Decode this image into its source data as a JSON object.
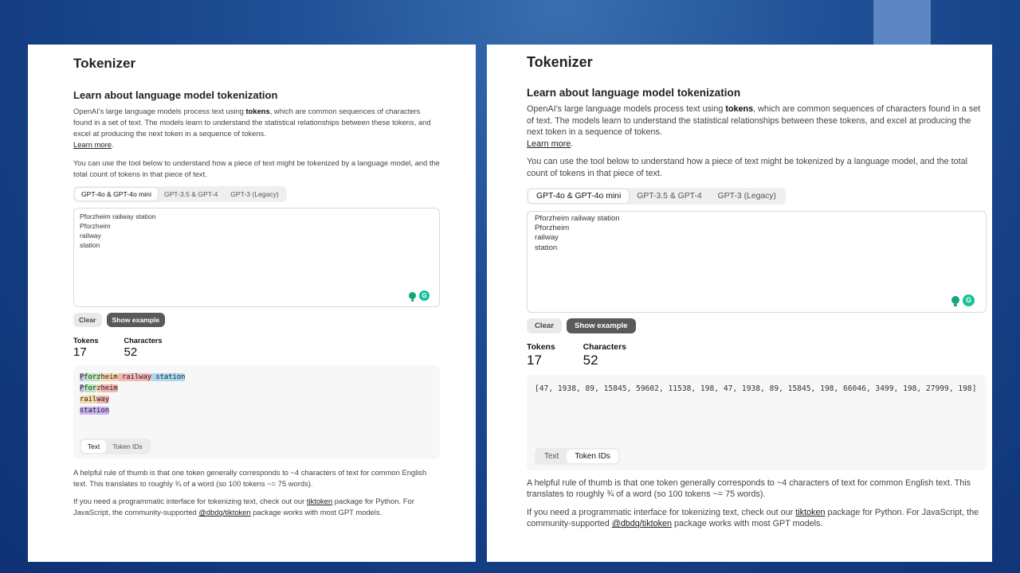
{
  "panels": [
    {
      "title": "Tokenizer",
      "subtitle": "Learn about language model tokenization",
      "intro_pre": "OpenAI's large language models process text using ",
      "intro_bold": "tokens",
      "intro_post": ", which are common sequences of characters found in a set of text. The models learn to understand the statistical relationships between these tokens, and excel at producing the next token in a sequence of tokens.",
      "learn_more": "Learn more",
      "usage": "You can use the tool below to understand how a piece of text might be tokenized by a language model, and the total count of tokens in that piece of text.",
      "model_tabs": [
        {
          "label": "GPT-4o & GPT-4o mini",
          "active": true
        },
        {
          "label": "GPT-3.5 & GPT-4",
          "active": false
        },
        {
          "label": "GPT-3 (Legacy)",
          "active": false
        }
      ],
      "input_text": "Pforzheim railway station\nPforzheim\nrailway\nstation",
      "clear_label": "Clear",
      "example_label": "Show example",
      "tokens_label": "Tokens",
      "tokens_value": "17",
      "chars_label": "Characters",
      "chars_value": "52",
      "view_tabs": [
        {
          "label": "Text",
          "active": true
        },
        {
          "label": "Token IDs",
          "active": false
        }
      ],
      "token_lines": [
        [
          {
            "t": "P",
            "c": "#c9b3f0"
          },
          {
            "t": "forz",
            "c": "#b8e6b8"
          },
          {
            "t": "heim",
            "c": "#f6d8a8"
          },
          {
            "t": " railway",
            "c": "#f4b6b6"
          },
          {
            "t": " station",
            "c": "#a9d9f2"
          }
        ],
        [
          {
            "t": "P",
            "c": "#c9b3f0"
          },
          {
            "t": "for",
            "c": "#b8e6b8"
          },
          {
            "t": "z",
            "c": "#f6d8a8"
          },
          {
            "t": "heim",
            "c": "#f4b6b6"
          }
        ],
        [
          {
            "t": "rail",
            "c": "#f6d8a8"
          },
          {
            "t": "way",
            "c": "#f4b6b6"
          }
        ],
        [
          {
            "t": "station",
            "c": "#c9b3f0"
          }
        ]
      ],
      "rule_text": "A helpful rule of thumb is that one token generally corresponds to ~4 characters of text for common English text. This translates to roughly ¾ of a word (so 100 tokens ~= 75 words).",
      "prog_pre": "If you need a programmatic interface for tokenizing text, check out our ",
      "tiktoken_link": "tiktoken",
      "prog_mid": " package for Python. For JavaScript, the community-supported ",
      "dbdq_link": "@dbdq/tiktoken",
      "prog_post": " package works with most GPT models."
    },
    {
      "title": "Tokenizer",
      "subtitle": "Learn about language model tokenization",
      "intro_pre": "OpenAI's large language models process text using ",
      "intro_bold": "tokens",
      "intro_post": ", which are common sequences of characters found in a set of text. The models learn to understand the statistical relationships between these tokens, and excel at producing the next token in a sequence of tokens.",
      "learn_more": "Learn more",
      "usage": "You can use the tool below to understand how a piece of text might be tokenized by a language model, and the total count of tokens in that piece of text.",
      "model_tabs": [
        {
          "label": "GPT-4o & GPT-4o mini",
          "active": true
        },
        {
          "label": "GPT-3.5 & GPT-4",
          "active": false
        },
        {
          "label": "GPT-3 (Legacy)",
          "active": false
        }
      ],
      "input_text": "Pforzheim railway station\nPforzheim\nrailway\nstation",
      "clear_label": "Clear",
      "example_label": "Show example",
      "tokens_label": "Tokens",
      "tokens_value": "17",
      "chars_label": "Characters",
      "chars_value": "52",
      "view_tabs": [
        {
          "label": "Text",
          "active": false
        },
        {
          "label": "Token IDs",
          "active": true
        }
      ],
      "token_ids": "[47, 1938, 89, 15845, 59602, 11538, 198, 47, 1938, 89, 15845, 198, 66046, 3499, 198, 27999, 198]",
      "rule_text": "A helpful rule of thumb is that one token generally corresponds to ~4 characters of text for common English text. This translates to roughly ¾ of a word (so 100 tokens ~= 75 words).",
      "prog_pre": "If you need a programmatic interface for tokenizing text, check out our ",
      "tiktoken_link": "tiktoken",
      "prog_mid": " package for Python. For JavaScript, the community-supported ",
      "dbdq_link": "@dbdq/tiktoken",
      "prog_post": " package works with most GPT models."
    }
  ]
}
